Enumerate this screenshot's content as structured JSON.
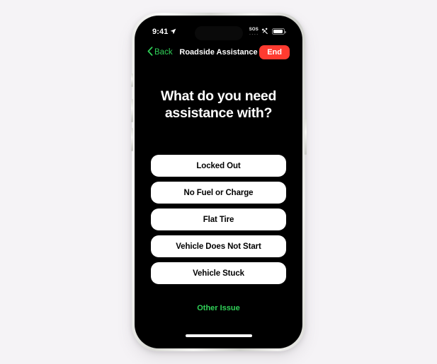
{
  "page": {
    "background_color": "#f5f3f6"
  },
  "device": {
    "frame_color": "#e4e4e0",
    "screen_background": "#000000",
    "buttons": {
      "silence_switch": "silence-switch",
      "volume_up": "volume-up",
      "volume_down": "volume-down",
      "power": "power-button"
    }
  },
  "status_bar": {
    "time": "9:41",
    "location_icon": "location-arrow-icon",
    "sos_label": "SOS",
    "sos_dashes": "- - - -",
    "satellite_icon": "satellite-icon",
    "battery_icon": "battery-icon",
    "battery_level_percent": 80
  },
  "nav_bar": {
    "back_label": "Back",
    "back_icon": "chevron-left-icon",
    "title": "Roadside Assistance",
    "end_label": "End",
    "accent_color": "#30d158",
    "end_color": "#ff3b30"
  },
  "main": {
    "heading": "What do you need assistance with?",
    "options": [
      {
        "label": "Locked Out"
      },
      {
        "label": "No Fuel or Charge"
      },
      {
        "label": "Flat Tire"
      },
      {
        "label": "Vehicle Does Not Start"
      },
      {
        "label": "Vehicle Stuck"
      }
    ],
    "other_issue_label": "Other Issue",
    "other_issue_color": "#30d158"
  }
}
